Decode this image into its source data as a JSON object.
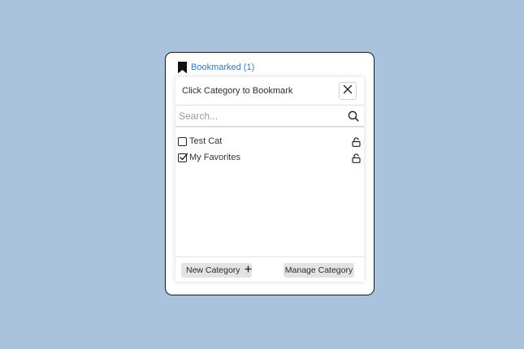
{
  "header": {
    "bookmark_label": "Bookmarked (1)",
    "icon": "bookmark-icon",
    "accent_color": "#2c7bbd"
  },
  "popover": {
    "title": "Click Category to Bookmark",
    "close_icon": "close-icon"
  },
  "search": {
    "value": "",
    "placeholder": "Search...",
    "icon": "search-icon"
  },
  "categories": [
    {
      "label": "Test Cat",
      "checked": false,
      "icon": "lock-icon"
    },
    {
      "label": "My Favorites",
      "checked": true,
      "icon": "lock-icon"
    }
  ],
  "footer": {
    "new_category_label": "New Category",
    "new_category_icon": "plus-icon",
    "manage_category_label": "Manage Category"
  }
}
